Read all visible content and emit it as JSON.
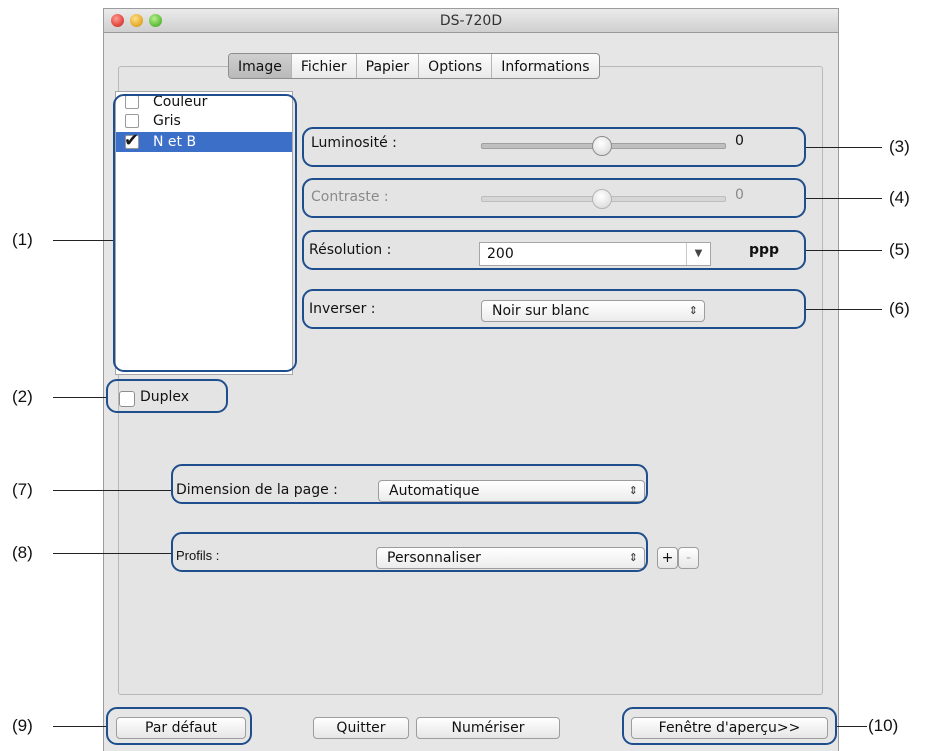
{
  "window": {
    "title": "DS-720D"
  },
  "tabs": [
    "Image",
    "Fichier",
    "Papier",
    "Options",
    "Informations"
  ],
  "color_modes": [
    {
      "label": "Couleur",
      "checked": false
    },
    {
      "label": "Gris",
      "checked": false
    },
    {
      "label": "N et B",
      "checked": true
    }
  ],
  "brightness": {
    "label": "Luminosité :",
    "value": "0"
  },
  "contrast": {
    "label": "Contraste :",
    "value": "0"
  },
  "resolution": {
    "label": "Résolution :",
    "value": "200",
    "unit": "ppp"
  },
  "invert": {
    "label": "Inverser :",
    "value": "Noir sur blanc"
  },
  "duplex": {
    "label": "Duplex",
    "checked": false
  },
  "page_size": {
    "label": "Dimension de la page :",
    "value": "Automatique"
  },
  "profiles": {
    "label": "Profils :",
    "value": "Personnaliser",
    "add": "+",
    "remove": "-"
  },
  "buttons": {
    "default": "Par défaut",
    "quit": "Quitter",
    "scan": "Numériser",
    "preview": "Fenêtre d'aperçu>>"
  },
  "annotations": [
    "(1)",
    "(2)",
    "(3)",
    "(4)",
    "(5)",
    "(6)",
    "(7)",
    "(8)",
    "(9)",
    "(10)"
  ]
}
